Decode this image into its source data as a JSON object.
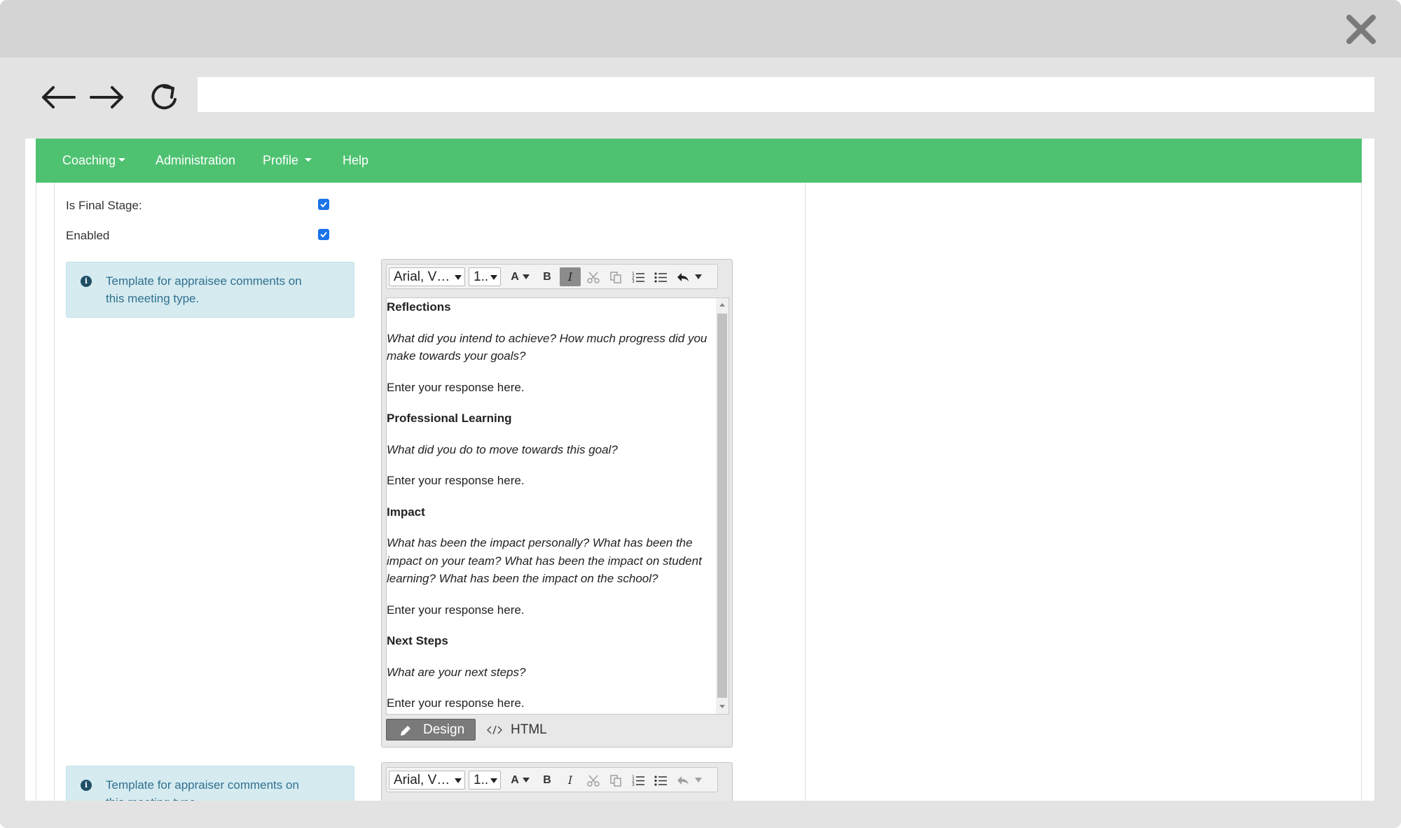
{
  "browser": {
    "url": "",
    "back_icon": "arrow-left-icon",
    "forward_icon": "arrow-right-icon",
    "reload_icon": "reload-icon",
    "close_icon": "close-icon"
  },
  "navbar": {
    "color": "#4ec271",
    "items": [
      {
        "label": "Coaching",
        "has_dropdown": true
      },
      {
        "label": "Administration",
        "has_dropdown": false
      },
      {
        "label": "Profile",
        "has_dropdown": true
      },
      {
        "label": "Help",
        "has_dropdown": false
      }
    ]
  },
  "form": {
    "is_final_stage": {
      "label": "Is Final Stage:",
      "checked": true
    },
    "enabled": {
      "label": "Enabled",
      "checked": true
    },
    "appraisee_template": {
      "info": "Template for appraisee comments on this meeting type.",
      "editor": {
        "font": "Arial, V…",
        "size": "1..",
        "content": [
          {
            "style": "bold",
            "text": "Reflections"
          },
          {
            "style": "italic",
            "text": "What did you intend to achieve? How much progress did you make towards your goals?"
          },
          {
            "style": "normal",
            "text": "Enter your response here."
          },
          {
            "style": "bold",
            "text": "Professional Learning"
          },
          {
            "style": "italic",
            "text": "What did you do to move towards this goal?"
          },
          {
            "style": "normal",
            "text": "Enter your response here."
          },
          {
            "style": "bold",
            "text": "Impact"
          },
          {
            "style": "italic",
            "text": "What has been the impact personally? What has been the impact on your team? What has been the impact on student learning? What has been the impact on the school?"
          },
          {
            "style": "normal",
            "text": "Enter your response here."
          },
          {
            "style": "bold",
            "text": "Next Steps"
          },
          {
            "style": "italic",
            "text": "What are your next steps?"
          },
          {
            "style": "normal",
            "text": "Enter your response here."
          }
        ],
        "mode_design": "Design",
        "mode_html": "HTML",
        "active_mode": "Design"
      }
    },
    "appraiser_template": {
      "info": "Template for appraiser comments on this meeting type.",
      "editor": {
        "font": "Arial, V…",
        "size": "1.."
      }
    }
  },
  "toolbar_labels": {
    "font_color": "A",
    "bold": "B",
    "italic": "I"
  }
}
